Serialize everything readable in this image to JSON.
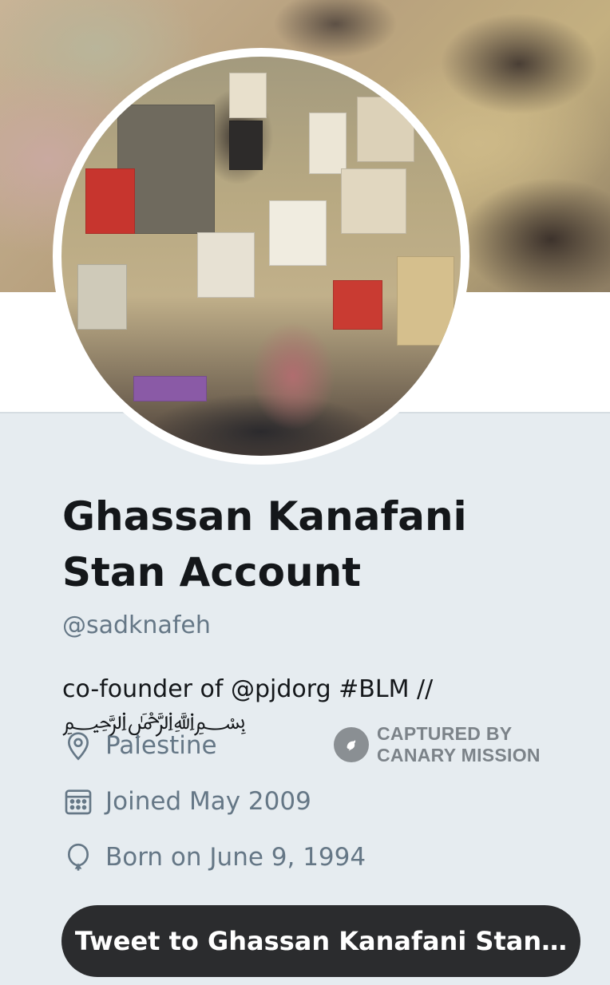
{
  "profile": {
    "name": "Ghassan Kanafani Stan Account",
    "handle": "@sadknafeh",
    "bio": "co-founder of @pjdorg #BLM // ﷽",
    "location": "Palestine",
    "joined": "Joined May 2009",
    "born": "Born on June 9, 1994"
  },
  "badge": {
    "line1": "CAPTURED BY",
    "line2": "CANARY MISSION"
  },
  "actions": {
    "tweet_to_label": "Tweet to Ghassan Kanafani Stan…"
  },
  "icons": {
    "location": "location-pin-icon",
    "joined": "calendar-icon",
    "born": "balloon-icon",
    "badge": "canary-bird-icon"
  },
  "colors": {
    "background": "#e6ecf0",
    "text_primary": "#14171a",
    "text_secondary": "#657786",
    "button_bg": "#2b2c2e",
    "button_text": "#ffffff"
  }
}
